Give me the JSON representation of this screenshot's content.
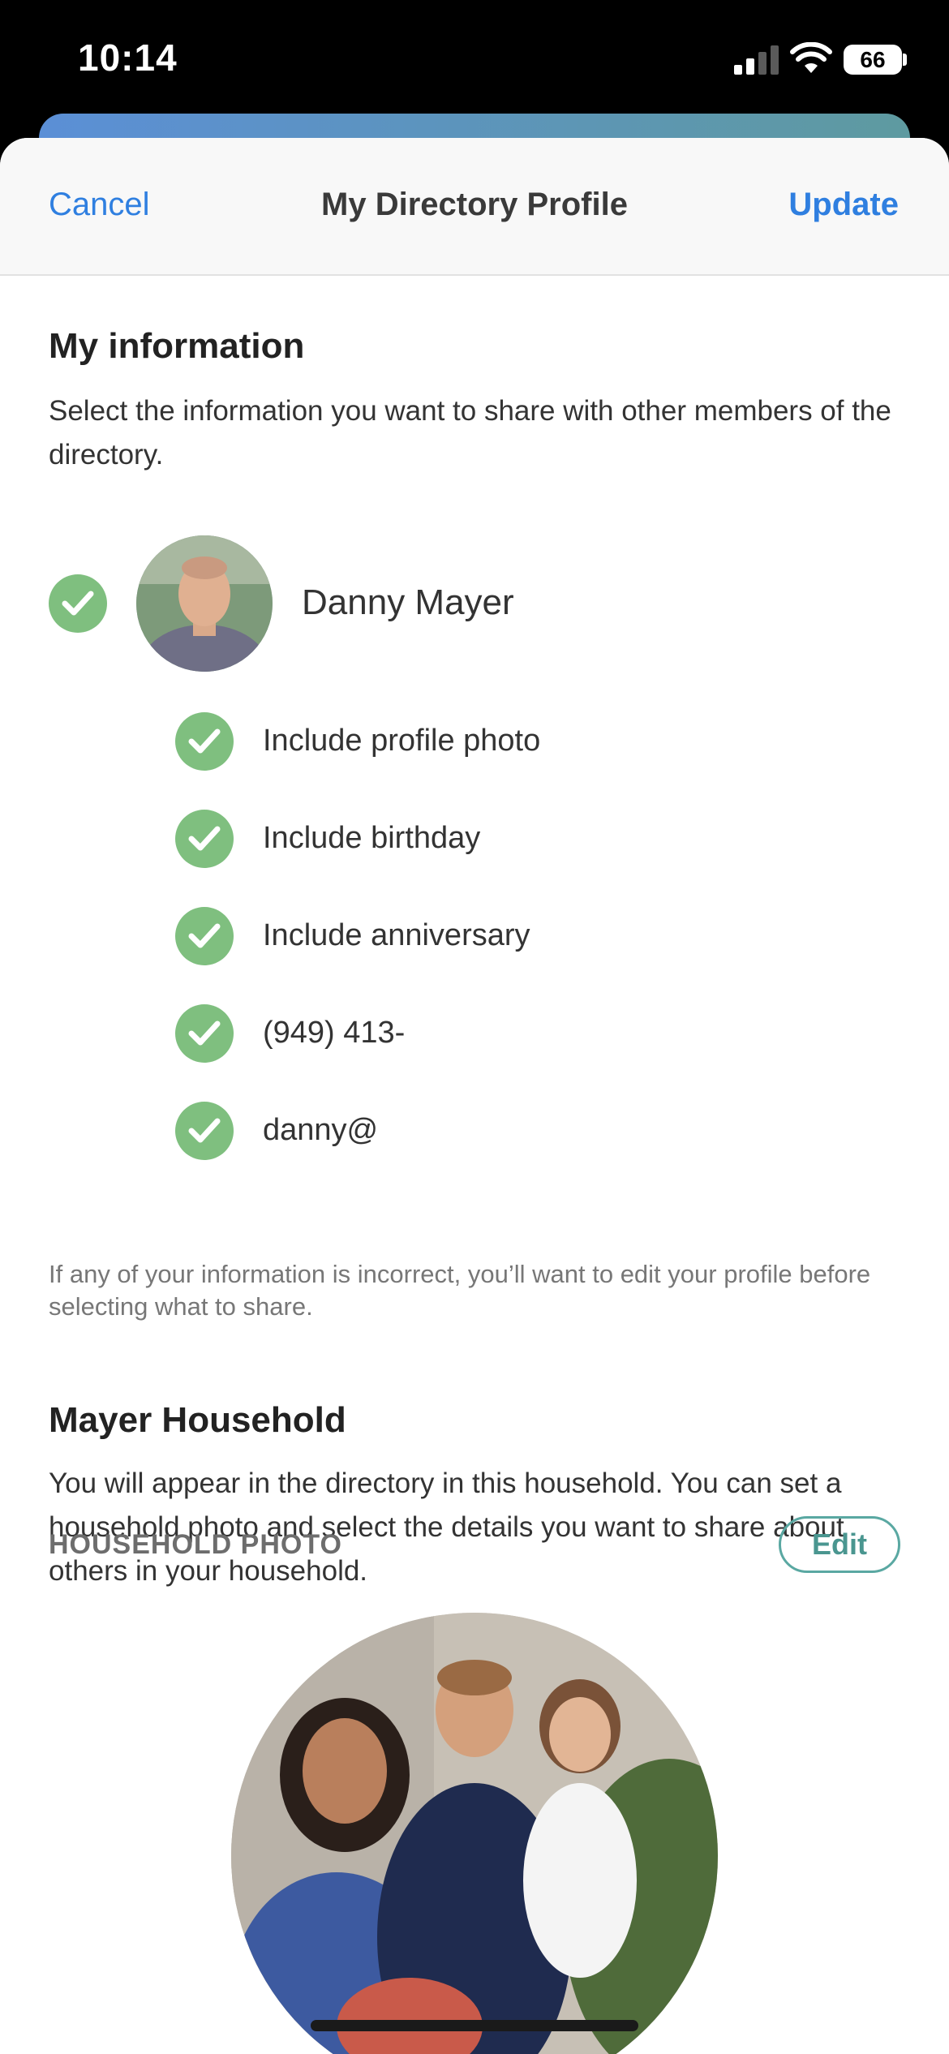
{
  "status_bar": {
    "time": "10:14",
    "battery": "66"
  },
  "nav": {
    "cancel": "Cancel",
    "title": "My Directory Profile",
    "update": "Update"
  },
  "my_information": {
    "title": "My information",
    "description": "Select the information you want to share with other members of the directory.",
    "name": "Danny Mayer",
    "options": [
      {
        "label": "Include profile photo",
        "checked": true
      },
      {
        "label": "Include birthday",
        "checked": true
      },
      {
        "label": "Include anniversary",
        "checked": true
      },
      {
        "label": "(949) 413-",
        "checked": true
      },
      {
        "label": "danny@",
        "checked": true
      }
    ],
    "note": "If any of your information is incorrect, you’ll want to edit your profile before selecting what to share."
  },
  "household": {
    "title": "Mayer Household",
    "description": "You will appear in the directory in this household. You can set a household photo and select the details you want to share about others in your household.",
    "photo_label": "HOUSEHOLD PHOTO",
    "edit": "Edit"
  },
  "colors": {
    "accent_blue": "#2f7fe0",
    "check_green": "#7fbf7f",
    "edit_teal": "#4a9690"
  }
}
